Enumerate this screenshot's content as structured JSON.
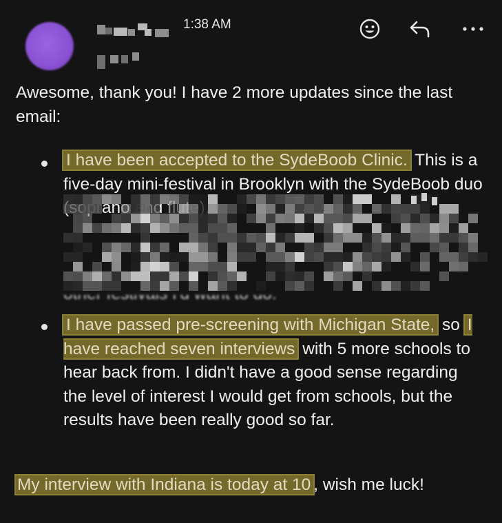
{
  "message": {
    "sender_name_redacted": true,
    "time": "1:38 AM",
    "actions": {
      "emoji_icon": "emoji-smile-icon",
      "reply_icon": "reply-arrow-icon",
      "more_icon": "more-dots-icon",
      "more_label": "•••"
    },
    "intro": "Awesome, thank you! I have 2 more updates since the last email:",
    "bullets": [
      {
        "highlight_1": "I have been accepted to the SydeBoob Clinic.",
        "text_1": " This is a five-day mini-festival in Brooklyn with the SydeBoob duo (soprano and flute).",
        "redacted_tail": "other festivals I'd want to do."
      },
      {
        "highlight_1": "I have passed pre-screening with Michigan State,",
        "text_1": " so ",
        "highlight_2": "I have reached seven interviews",
        "text_2": " with 5 more schools to hear back from. I didn't have a good sense regarding the level of interest I would get from schools, but the results have been really good so far."
      }
    ],
    "closing_highlight": "My interview with Indiana is today at 10",
    "closing_text": ", wish me luck!"
  }
}
